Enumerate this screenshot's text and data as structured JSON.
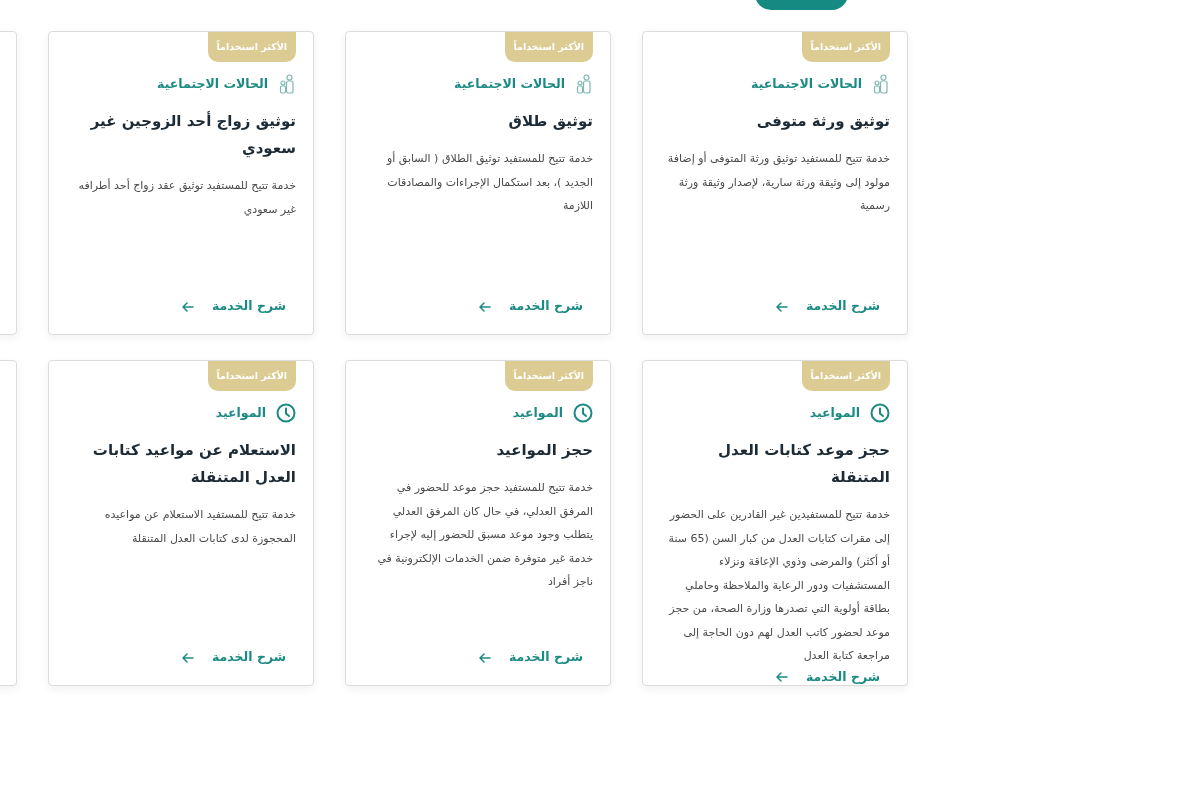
{
  "nav": {
    "button": {
      "kind": "primary"
    }
  },
  "cards": [
    {
      "kind": "full",
      "badge": "الأكثر استخداماً",
      "category": {
        "kind": "people",
        "label": "الحالات الاجتماعية"
      },
      "title": "توثيق ورثة متوفى",
      "description": "خدمة تتيح للمستفيد توثيق ورثة المتوفى أو إضافة مولود إلى وثيقة ورثة سارية، لإصدار وثيقة ورثة رسمية",
      "link": "شرح الخدمة"
    },
    {
      "kind": "full",
      "badge": "الأكثر استخداماً",
      "category": {
        "kind": "people",
        "label": "الحالات الاجتماعية"
      },
      "title": "توثيق طلاق",
      "description": "خدمة تتيح للمستفيد توثيق الطلاق ( السابق أو الجديد )، بعد استكمال الإجراءات والمصادقات اللازمة",
      "link": "شرح الخدمة"
    },
    {
      "kind": "full",
      "badge": "الأكثر استخداماً",
      "category": {
        "kind": "people",
        "label": "الحالات الاجتماعية"
      },
      "title": "توثيق زواج أحد الزوجين غير سعودي",
      "description": "خدمة تتيح للمستفيد توثيق عقد زواج أحد أطرافه غير سعودي",
      "link": "شرح الخدمة"
    },
    {
      "kind": "partial"
    },
    {
      "kind": "full",
      "badge": "الأكثر استخداماً",
      "category": {
        "kind": "clock",
        "label": "المواعيد"
      },
      "title": "حجز موعد كتابات العدل المتنقلة",
      "description": "خدمة تتيح للمستفيدين غير القادرين على الحضور إلى مقرات كتابات العدل من كبار السن (65 سنة أو أكثر) والمرضى وذوي الإعاقة ونزلاء المستشفيات ودور الرعاية والملاحظة وحاملي بطاقة أولوية التي تصدرها وزارة الصحة، من حجز موعد لحضور كاتب العدل لهم دون الحاجة إلى مراجعة كتابة العدل",
      "link": "شرح الخدمة"
    },
    {
      "kind": "full",
      "badge": "الأكثر استخداماً",
      "category": {
        "kind": "clock",
        "label": "المواعيد"
      },
      "title": "حجز المواعيد",
      "description": "خدمة تتيح للمستفيد حجز موعد للحضور في المرفق العدلي، في حال كان المرفق العدلي يتطلب وجود موعد مسبق للحضور إليه لإجراء خدمة غير متوفرة ضمن الخدمات الإلكترونية في ناجز أفراد",
      "link": "شرح الخدمة"
    },
    {
      "kind": "full",
      "badge": "الأكثر استخداماً",
      "category": {
        "kind": "clock",
        "label": "المواعيد"
      },
      "title": "الاستعلام عن مواعيد كتابات العدل المتنقلة",
      "description": "خدمة تتيح للمستفيد الاستعلام عن مواعيده المحجوزة لدى كتابات العدل المتنقلة",
      "link": "شرح الخدمة"
    },
    {
      "kind": "partial"
    }
  ]
}
